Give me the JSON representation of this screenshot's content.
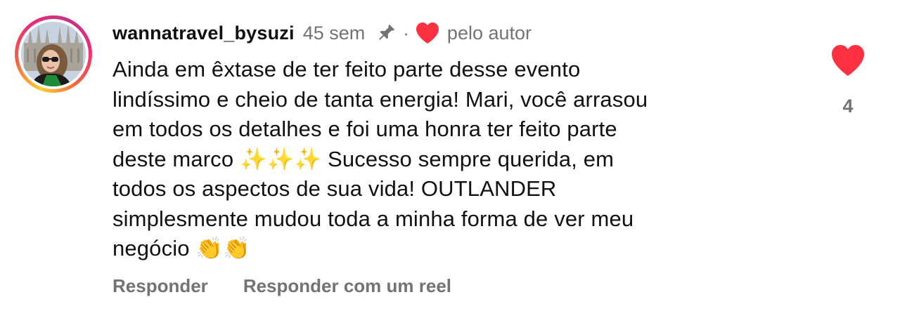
{
  "comment": {
    "username": "wannatravel_bysuzi",
    "time": "45 sem",
    "separator": "·",
    "liked_by_author_label": "pelo autor",
    "text": "Ainda em êxtase de ter feito parte desse evento\nlindíssimo e cheio de tanta energia! Mari, você arrasou\nem todos os detalhes e foi uma honra ter feito parte\ndeste marco ✨✨✨ Sucesso sempre querida, em\ntodos os aspectos de sua vida! OUTLANDER\nsimplesmente mudou toda a minha forma de ver meu\nnegócio 👏👏",
    "like_count": "4",
    "liked": true
  },
  "actions": {
    "reply_label": "Responder",
    "reply_reel_label": "Responder com um reel"
  },
  "icons": {
    "pin": "pin-icon",
    "author_heart": "heart-icon",
    "like": "heart-filled-icon"
  },
  "colors": {
    "heart_red": "#ff3040",
    "secondary_text": "#737373",
    "primary_text": "#111111",
    "story_ring_start": "#f9ce34",
    "story_ring_mid": "#ee2a7b",
    "story_ring_end": "#c13584"
  }
}
